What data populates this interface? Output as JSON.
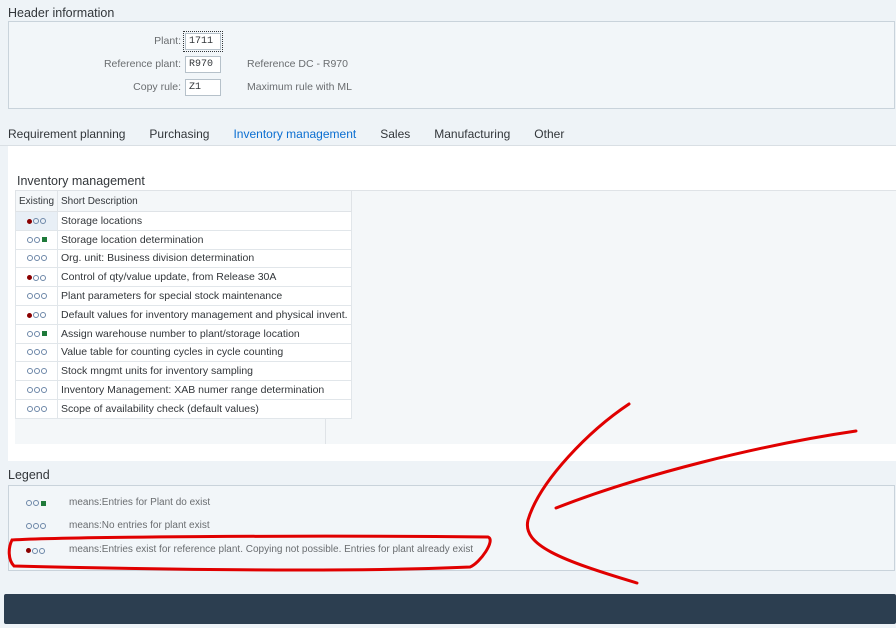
{
  "header": {
    "title": "Header information",
    "plant_label": "Plant:",
    "plant_value": "1711",
    "ref_plant_label": "Reference plant:",
    "ref_plant_value": "R970",
    "ref_plant_desc": "Reference DC - R970",
    "copy_rule_label": "Copy rule:",
    "copy_rule_value": "Z1",
    "copy_rule_desc": "Maximum rule with ML"
  },
  "tabs": [
    {
      "label": "Requirement planning"
    },
    {
      "label": "Purchasing"
    },
    {
      "label": "Inventory management",
      "active": true
    },
    {
      "label": "Sales"
    },
    {
      "label": "Manufacturing"
    },
    {
      "label": "Other"
    }
  ],
  "inventory": {
    "title": "Inventory management",
    "col_existing": "Existing",
    "col_desc": "Short Description",
    "rows": [
      {
        "status": "red",
        "desc": "Storage locations"
      },
      {
        "status": "green",
        "desc": "Storage location determination"
      },
      {
        "status": "none",
        "desc": "Org. unit: Business division determination"
      },
      {
        "status": "red",
        "desc": "Control of qty/value update, from Release 30A"
      },
      {
        "status": "none",
        "desc": "Plant parameters for special stock maintenance"
      },
      {
        "status": "red",
        "desc": "Default values for inventory management and physical invent."
      },
      {
        "status": "green",
        "desc": "Assign warehouse number to plant/storage location"
      },
      {
        "status": "none",
        "desc": "Value table for counting cycles in cycle counting"
      },
      {
        "status": "none",
        "desc": "Stock mngmt units for inventory sampling"
      },
      {
        "status": "none",
        "desc": "Inventory Management: XAB numer range determination"
      },
      {
        "status": "none",
        "desc": "Scope of availability check (default values)"
      }
    ]
  },
  "legend": {
    "title": "Legend",
    "items": [
      {
        "status": "green",
        "text": "means:Entries for Plant do exist"
      },
      {
        "status": "none",
        "text": "means:No entries for plant exist"
      },
      {
        "status": "red",
        "text": "means:Entries exist for reference plant. Copying not possible. Entries for plant already exist"
      }
    ]
  },
  "colors": {
    "active_tab": "#0a6ed1",
    "red_indicator": "#8b0000",
    "green_indicator": "#1f7a3a",
    "annotation": "#e00000"
  }
}
